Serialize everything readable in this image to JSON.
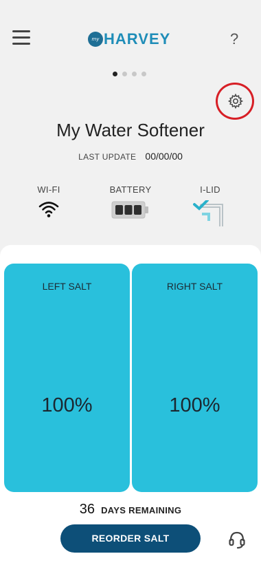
{
  "header": {
    "logo_prefix": "my",
    "logo_text": "HARVEY",
    "help_label": "?"
  },
  "pager": {
    "total": 4,
    "active_index": 0
  },
  "device": {
    "title": "My Water Softener",
    "last_update_label": "LAST UPDATE",
    "last_update_value": "00/00/00"
  },
  "status": {
    "wifi_label": "WI-FI",
    "battery_label": "BATTERY",
    "battery_level": 1.0,
    "ilid_label": "I-LID"
  },
  "salt": {
    "left_label": "LEFT SALT",
    "left_value": "100%",
    "right_label": "RIGHT SALT",
    "right_value": "100%"
  },
  "remaining": {
    "days": "36",
    "label": "DAYS REMAINING"
  },
  "actions": {
    "reorder_label": "REORDER SALT"
  },
  "colors": {
    "accent": "#29c0dc",
    "button": "#0d4f78",
    "highlight_ring": "#d71f26",
    "brand": "#1f8db8"
  },
  "icons": {
    "menu": "hamburger-icon",
    "settings": "gear-icon",
    "wifi": "wifi-icon",
    "battery": "battery-icon",
    "ilid": "lid-check-icon",
    "support": "headset-icon"
  }
}
